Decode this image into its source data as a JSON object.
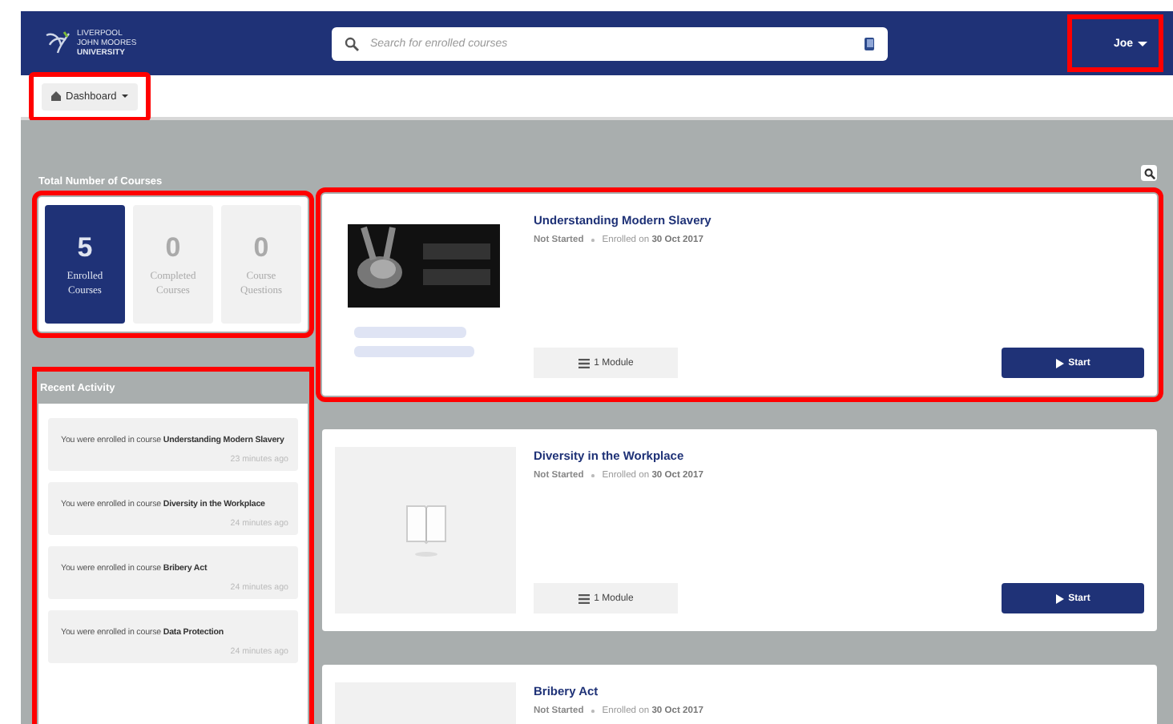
{
  "header": {
    "logo_lines": [
      "LIVERPOOL",
      "JOHN MOORES",
      "UNIVERSITY"
    ],
    "search": {
      "placeholder": "Search for enrolled courses"
    },
    "user": {
      "label": "Joe",
      "highlighted": true
    }
  },
  "subbar": {
    "dashboard": {
      "label": "Dashboard",
      "highlighted": true
    }
  },
  "stats": {
    "title": "Total Number of Courses",
    "highlighted": true,
    "tiles": [
      {
        "count": "5",
        "label": "Enrolled Courses",
        "selected": true
      },
      {
        "count": "0",
        "label": "Completed Courses",
        "selected": false
      },
      {
        "count": "0",
        "label": "Course Questions",
        "selected": false
      }
    ]
  },
  "activity": {
    "title": "Recent Activity",
    "highlighted": true,
    "items": [
      {
        "text": "You were enrolled in course **Understanding Modern Slavery**",
        "time": "23 minutes ago"
      },
      {
        "text": "You were enrolled in course **Diversity in the Workplace**",
        "time": "24 minutes ago"
      },
      {
        "text": "You were enrolled in course **Bribery Act**",
        "time": "24 minutes ago"
      },
      {
        "text": "You were enrolled in course **Data Protection**",
        "time": "24 minutes ago"
      }
    ]
  },
  "courses": [
    {
      "title": "Understanding Modern Slavery",
      "status": "Not Started",
      "enrolled": "Enrolled on **30 Oct 2017**",
      "modules": "1 Module",
      "action": "Start",
      "kind": "picture",
      "highlighted": true
    },
    {
      "title": "Diversity in the Workplace",
      "status": "Not Started",
      "enrolled": "Enrolled on **30 Oct 2017**",
      "modules": "1 Module",
      "action": "Start",
      "kind": "placeholder",
      "highlighted": false
    },
    {
      "title": "Bribery Act",
      "status": "Not Started",
      "enrolled": "Enrolled on **30 Oct 2017**",
      "kind": "placeholder",
      "highlighted": false
    }
  ]
}
